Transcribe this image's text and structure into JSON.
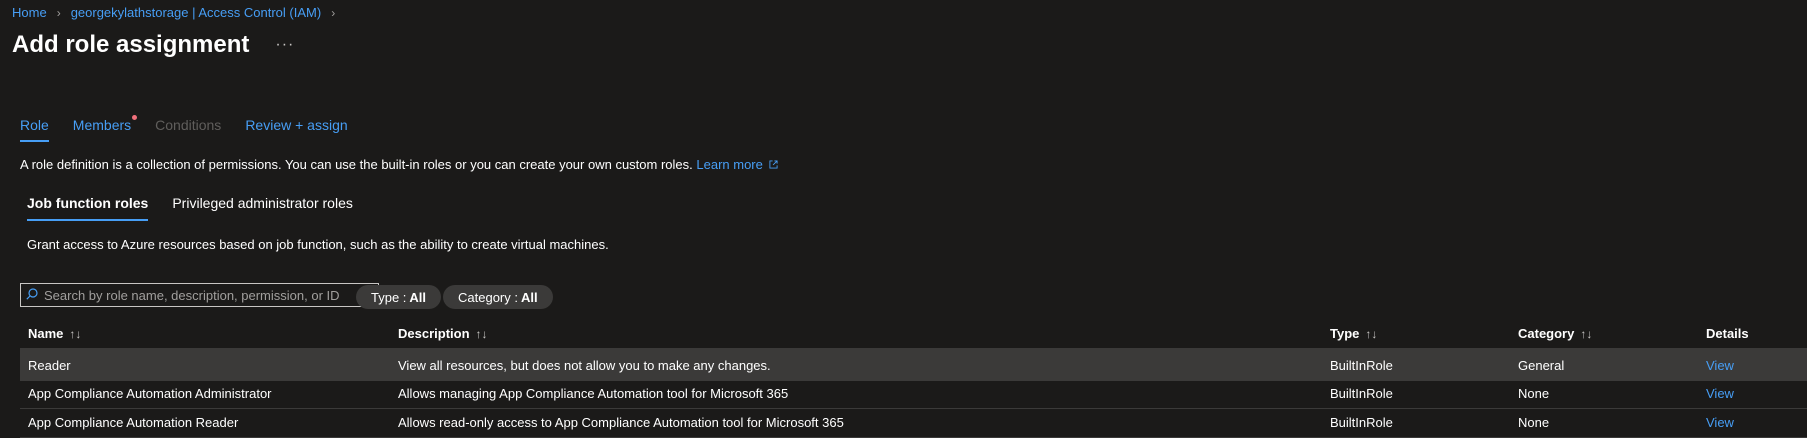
{
  "breadcrumb": [
    "Home",
    "georgekylathstorage | Access Control (IAM)"
  ],
  "page_title": "Add role assignment",
  "more_label": "···",
  "tabs": [
    {
      "label": "Role",
      "state": "active"
    },
    {
      "label": "Members",
      "state": "normal"
    },
    {
      "label": "Conditions",
      "state": "disabled"
    },
    {
      "label": "Review + assign",
      "state": "normal"
    }
  ],
  "intro": {
    "text": "A role definition is a collection of permissions. You can use the built-in roles or you can create your own custom roles.",
    "link": "Learn more"
  },
  "subtabs": [
    {
      "label": "Job function roles",
      "active": true
    },
    {
      "label": "Privileged administrator roles",
      "active": false
    }
  ],
  "subtab_description": "Grant access to Azure resources based on job function, such as the ability to create virtual machines.",
  "search": {
    "placeholder": "Search by role name, description, permission, or ID",
    "value": ""
  },
  "filters": [
    {
      "label": "Type :",
      "value": "All"
    },
    {
      "label": "Category :",
      "value": "All"
    }
  ],
  "table": {
    "columns": [
      "Name",
      "Description",
      "Type",
      "Category",
      "Details"
    ],
    "rows": [
      {
        "name": "Reader",
        "description": "View all resources, but does not allow you to make any changes.",
        "type": "BuiltInRole",
        "category": "General",
        "details": "View",
        "selected": true
      },
      {
        "name": "App Compliance Automation Administrator",
        "description": "Allows managing App Compliance Automation tool for Microsoft 365",
        "type": "BuiltInRole",
        "category": "None",
        "details": "View",
        "selected": false
      },
      {
        "name": "App Compliance Automation Reader",
        "description": "Allows read-only access to App Compliance Automation tool for Microsoft 365",
        "type": "BuiltInRole",
        "category": "None",
        "details": "View",
        "selected": false
      }
    ]
  },
  "colors": {
    "background": "#1b1a19",
    "accent": "#479ef5",
    "selected_row": "#3b3a39",
    "notification_dot": "#f1707b"
  }
}
